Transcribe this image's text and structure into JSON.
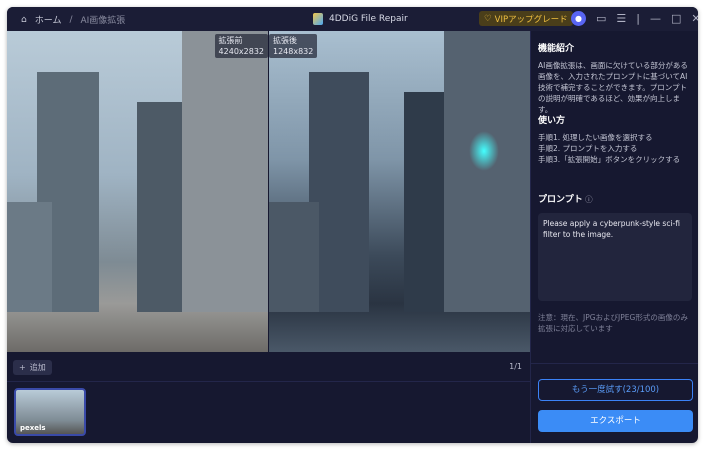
{
  "titlebar": {
    "home": "ホーム",
    "separator": "/",
    "current": "AI画像拡張",
    "app_title": "4DDiG File Repair",
    "vip": "VIPアップグレード"
  },
  "preview": {
    "before_label": "拡張前",
    "before_size": "4240x2832",
    "after_label": "拡張後",
    "after_size": "1248x832"
  },
  "bottombar": {
    "add": "追加",
    "page": "1/1"
  },
  "thumbnail": {
    "watermark": "pexels"
  },
  "panel": {
    "intro_title": "機能紹介",
    "intro_text": "AI画像拡張は、画面に欠けている部分がある画像を、入力されたプロンプトに基づいてAI技術で補完することができます。プロンプトの説明が明確であるほど、効果が向上します。",
    "howto_title": "使い方",
    "steps": [
      "手順1. 処理したい画像を選択する",
      "手順2. プロンプトを入力する",
      "手順3.「拡張開始」ボタンをクリックする"
    ],
    "prompt_title": "プロンプト",
    "prompt_value": "Please apply a cyberpunk-style sci-fi filter to the image.",
    "note": "注意：現在、JPGおよびJPEG形式の画像のみ拡張に対応しています",
    "retry": "もう一度試す(23/100)",
    "export": "エクスポート"
  },
  "colors": {
    "accent": "#3b8cf6",
    "background": "#161830",
    "vip": "#f0c040"
  }
}
